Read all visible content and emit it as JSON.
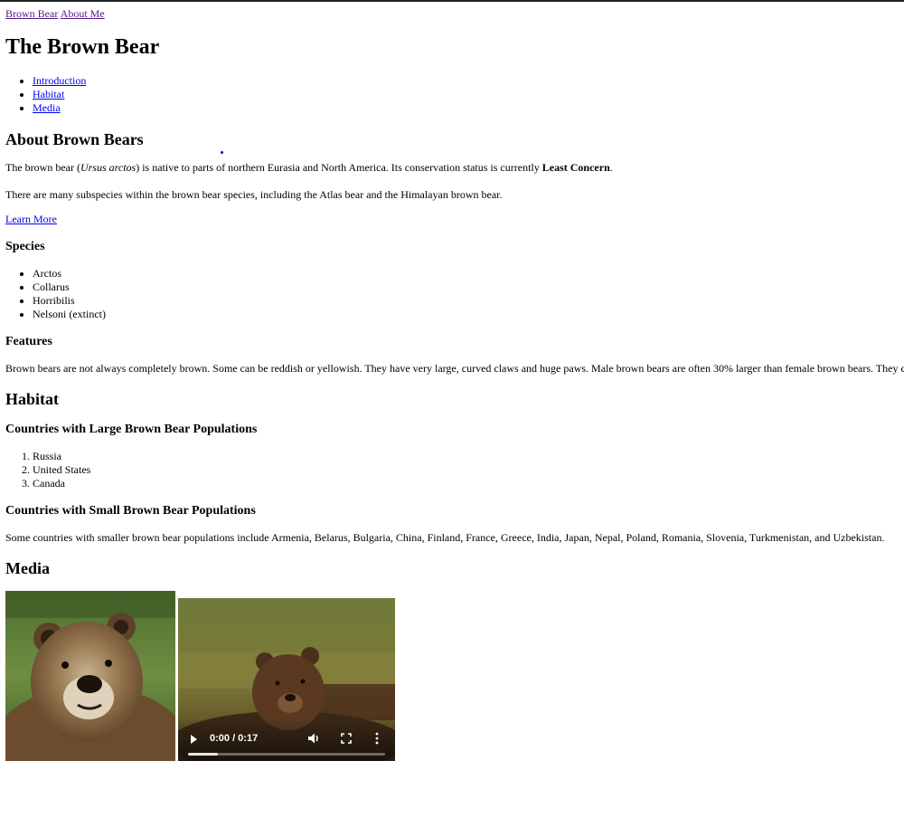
{
  "nav": {
    "brown_bear": "Brown Bear",
    "about_me": "About Me"
  },
  "page_title": "The Brown Bear",
  "toc": [
    "Introduction",
    "Habitat",
    "Media"
  ],
  "about": {
    "heading": "About Brown Bears",
    "p1_a": "The brown bear (",
    "p1_species": "Ursus arctos",
    "p1_b": ") is native to parts of northern Eurasia and North America. Its conservation status is currently ",
    "p1_status": "Least Concern",
    "p1_c": ".",
    "p2": "There are many subspecies within the brown bear species, including the Atlas bear and the Himalayan brown bear.",
    "learn_more": "Learn More"
  },
  "species": {
    "heading": "Species",
    "items": [
      "Arctos",
      "Collarus",
      "Horribilis",
      "Nelsoni (extinct)"
    ]
  },
  "features": {
    "heading": "Features",
    "text": "Brown bears are not always completely brown. Some can be reddish or yellowish. They have very large, curved claws and huge paws. Male brown bears are often 30% larger than female brown bears. They c"
  },
  "habitat": {
    "heading": "Habitat",
    "large_heading": "Countries with Large Brown Bear Populations",
    "large_items": [
      "Russia",
      "United States",
      "Canada"
    ],
    "small_heading": "Countries with Small Brown Bear Populations",
    "small_text": "Some countries with smaller brown bear populations include Armenia, Belarus, Bulgaria, China, Finland, France, Greece, India, Japan, Nepal, Poland, Romania, Slovenia, Turkmenistan, and Uzbekistan."
  },
  "media": {
    "heading": "Media",
    "image_icon": "brown-bear-photo",
    "video": {
      "time": "0:00 / 0:17",
      "progress": 0.15
    }
  },
  "colors": {
    "link": "#0000ee",
    "visited": "#551a8b"
  }
}
